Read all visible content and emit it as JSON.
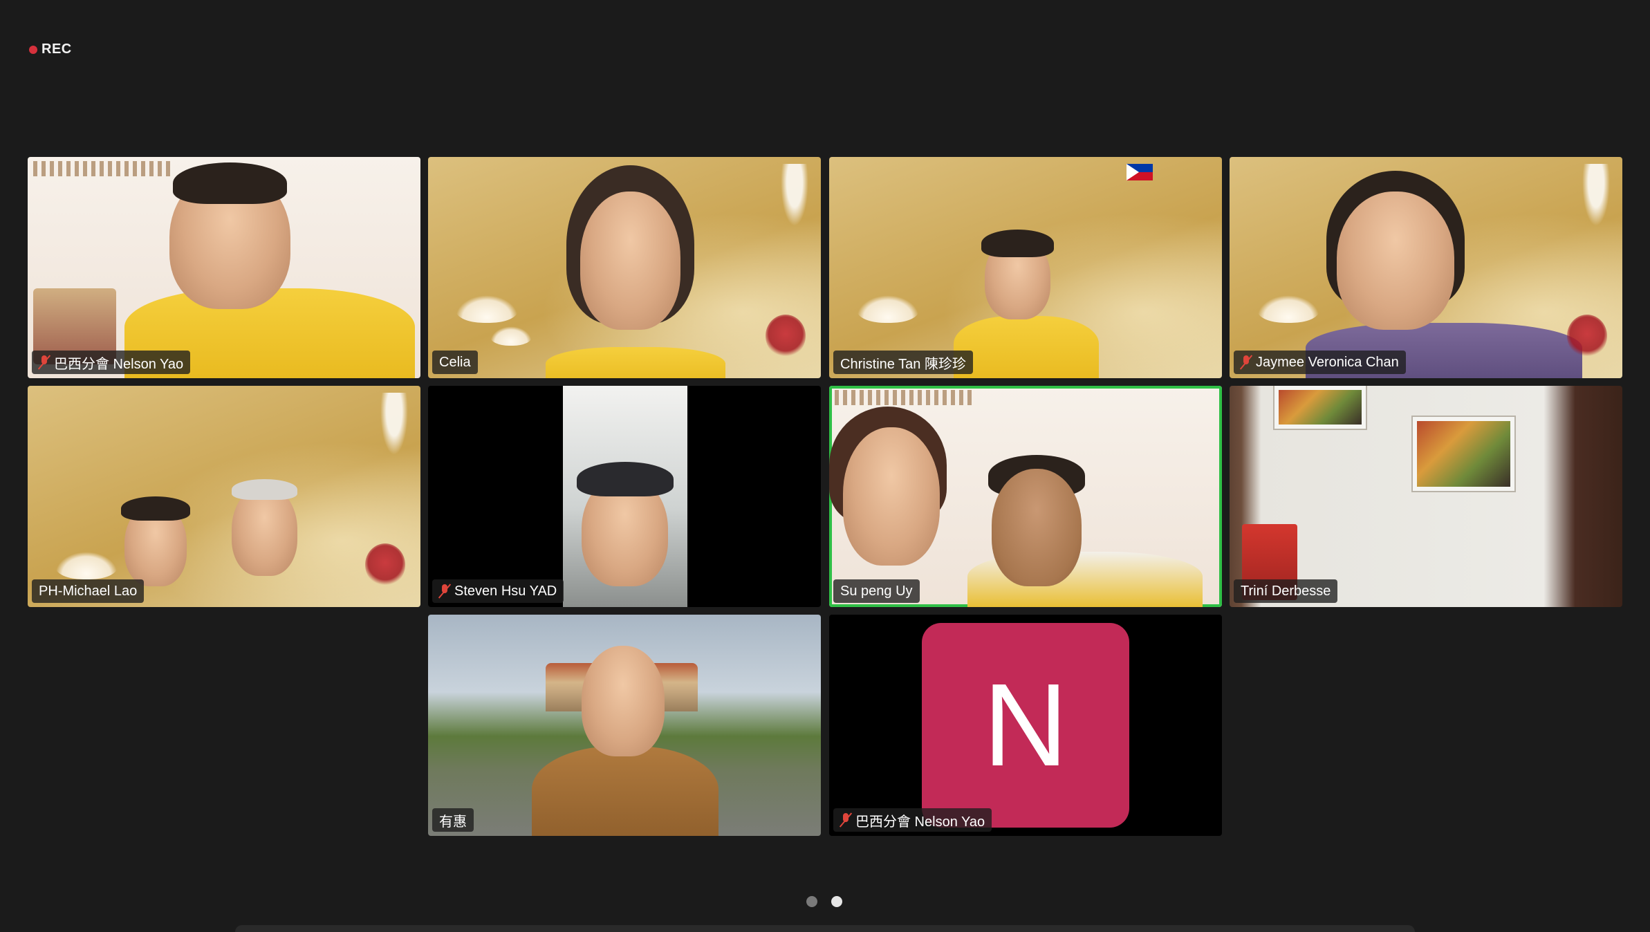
{
  "recording": {
    "label": "REC",
    "dot_color": "#d6313c"
  },
  "participants": [
    {
      "name": "巴西分會 Nelson Yao",
      "muted": true
    },
    {
      "name": "Celia",
      "muted": false
    },
    {
      "name": "Christine Tan 陳珍珍",
      "muted": false
    },
    {
      "name": "Jaymee Veronica Chan",
      "muted": true
    },
    {
      "name": "PH-Michael Lao",
      "muted": false
    },
    {
      "name": "Steven Hsu YAD",
      "muted": true
    },
    {
      "name": "Su peng Uy",
      "muted": false,
      "speaking": true
    },
    {
      "name": "Triní Derbesse",
      "muted": false
    },
    {
      "name": "有惠",
      "muted": false
    },
    {
      "name": "巴西分會 Nelson Yao",
      "muted": true,
      "avatar_letter": "N",
      "avatar_color": "#c22a57"
    }
  ],
  "pagination": {
    "pages": 2,
    "current": 2
  },
  "colors": {
    "speaking_border": "#2fbf46",
    "mic_off": "#e0453b"
  }
}
